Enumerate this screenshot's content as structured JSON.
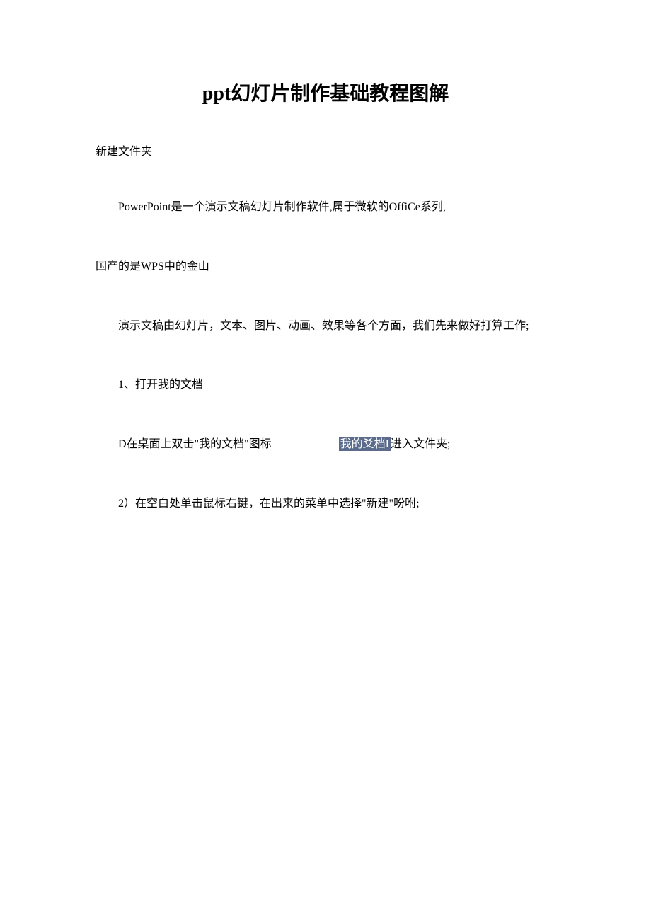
{
  "title": {
    "prefix": "ppt",
    "rest": "幻灯片制作基础教程图解"
  },
  "section": "新建文件夹",
  "para1_part1": "PowerPoint是一个演示文稿幻灯片制作软件,属于微软的OffiCe系列,",
  "para1_part2": "国产的是WPS中的金山",
  "para2": "演示文稿由幻灯片，文本、图片、动画、效果等各个方面，我们先来做好打算工作;",
  "step1_heading": "1、打开我的文档",
  "step1_sub1_before": "D在桌面上双击\"我的文档\"图标",
  "step1_sub1_highlight": "我的爻档I",
  "step1_sub1_after": "进入文件夹;",
  "step1_sub2": "2）在空白处单击鼠标右键，在出来的菜单中选择\"新建\"吩咐;"
}
